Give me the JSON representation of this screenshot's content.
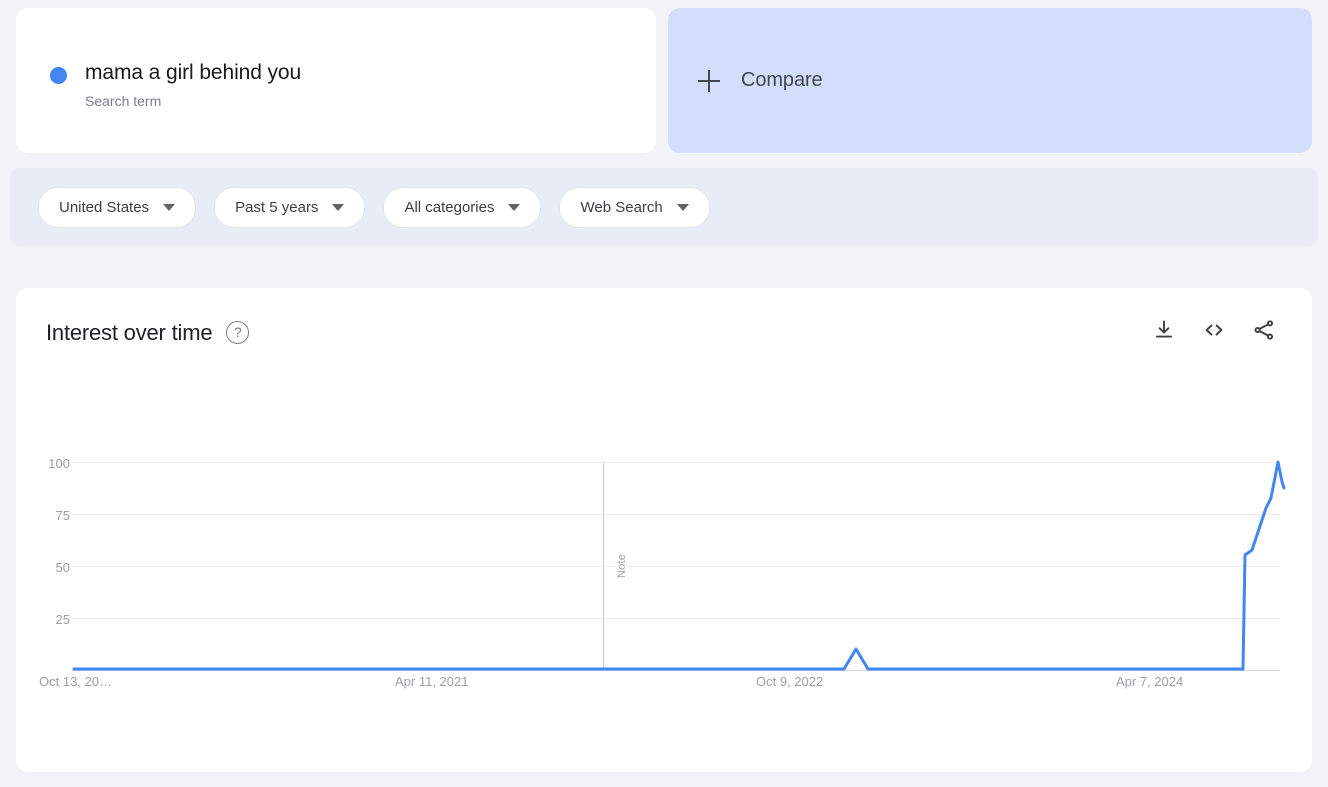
{
  "search_term": {
    "name": "mama a girl behind you",
    "type_label": "Search term",
    "dot_color": "#4285f4"
  },
  "compare": {
    "label": "Compare",
    "icon": "plus-icon",
    "background": "#d3dffa"
  },
  "filters": [
    {
      "label": "United States",
      "icon": "chevron-down-icon"
    },
    {
      "label": "Past 5 years",
      "icon": "chevron-down-icon"
    },
    {
      "label": "All categories",
      "icon": "chevron-down-icon"
    },
    {
      "label": "Web Search",
      "icon": "chevron-down-icon"
    }
  ],
  "chart_card": {
    "title": "Interest over time",
    "help_icon": "help-circle-icon",
    "actions": [
      {
        "name": "download-icon",
        "label": "Download"
      },
      {
        "name": "embed-code-icon",
        "label": "Embed"
      },
      {
        "name": "share-icon",
        "label": "Share"
      }
    ]
  },
  "chart_data": {
    "type": "line",
    "title": "Interest over time",
    "xlabel": "",
    "ylabel": "",
    "ylim": [
      0,
      100
    ],
    "yticks": [
      "25",
      "50",
      "75",
      "100"
    ],
    "ytick_values": [
      25,
      50,
      75,
      100
    ],
    "xticks": [
      "Oct 13, 20…",
      "Apr 11, 2021",
      "Oct 9, 2022",
      "Apr 7, 2024"
    ],
    "xtick_positions_pct": [
      0,
      29.8,
      59.6,
      89.5
    ],
    "grid": true,
    "legend": false,
    "line_color": "#4285f4",
    "annotations": [
      {
        "label": "Note",
        "type": "vertical-line",
        "x_pct": 44.0
      }
    ],
    "series": [
      {
        "name": "mama a girl behind you",
        "color": "#4285f4",
        "x": [
          0,
          5,
          10,
          15,
          20,
          25,
          30,
          35,
          40,
          45,
          50,
          55,
          60,
          63.5,
          64.5,
          65.5,
          70,
          75,
          80,
          85,
          90,
          92,
          94,
          95.2,
          95.6,
          96.2,
          97,
          98.2,
          99.2,
          100
        ],
        "values": [
          0,
          0,
          0,
          0,
          0,
          0,
          0,
          0,
          0,
          0,
          0,
          0,
          0,
          0,
          10,
          0,
          0,
          0,
          0,
          0,
          0,
          0,
          0,
          0,
          55,
          58,
          72,
          100,
          92,
          85
        ]
      }
    ]
  }
}
